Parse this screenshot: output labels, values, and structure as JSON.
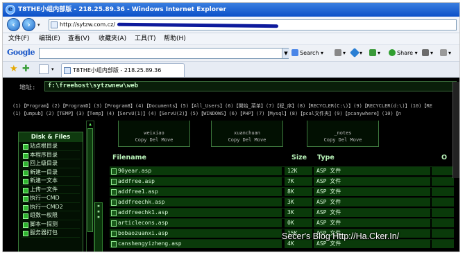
{
  "window": {
    "title": "T8THE小组内部版 - 218.25.89.36 - Windows Internet Explorer"
  },
  "address": {
    "url": "http://sytzw.com.cz/"
  },
  "menu": {
    "items": [
      "文件(F)",
      "编辑(E)",
      "查看(V)",
      "收藏夹(A)",
      "工具(T)",
      "帮助(H)"
    ]
  },
  "google": {
    "logo": "Google",
    "search_label": "Search",
    "share_label": "Share"
  },
  "tab": {
    "title": "T8THE小组内部版 - 218.25.89.36"
  },
  "page": {
    "path_label": "地址:",
    "path_value": "f:\\freehost\\sytzwnew\\web",
    "drives_row1": "(1)【Program】(2)【ProgramD】(3)【Program8】(4)【Documents】(5)【All_Users】(6)【開始_菜单】(7)【程_序】(8)【RECYCLER(C:\\)】(9)【RECYCLER(d:\\)】(10)【RE",
    "drives_row2": "(1)【umpub】(2)【TEMP】(3)【Temp】(4)【ServU(1)】(4)【ServU(2)】(5)【WINDOWS】(6)【PHP】(7)【Mysql】(8)【pcal文件夹】(9)【pcanywhere】(10)【n",
    "sidebar": {
      "title": "Disk & Files",
      "items": [
        "站点根目录",
        "本程序目录",
        "回上级目录",
        "新建一目录",
        "新建一文本",
        "上传一文件",
        "执行一CMD",
        "执行一CMD2",
        "组数一权限",
        "脚本一探测",
        "服务器打包"
      ]
    },
    "folders": [
      {
        "name": "weixiao",
        "ops": "Copy Del Move"
      },
      {
        "name": "xuanchuan",
        "ops": "Copy Del Move"
      },
      {
        "name": "_notes",
        "ops": "Copy Del Move"
      }
    ],
    "table": {
      "headers": {
        "name": "Filename",
        "size": "Size",
        "type": "Type",
        "extra": "O"
      },
      "rows": [
        {
          "name": "90year.asp",
          "size": "12K",
          "type": "ASP 文件"
        },
        {
          "name": "addfree.asp",
          "size": "7K",
          "type": "ASP 文件"
        },
        {
          "name": "addfree1.asp",
          "size": "8K",
          "type": "ASP 文件"
        },
        {
          "name": "addfreechk.asp",
          "size": "3K",
          "type": "ASP 文件"
        },
        {
          "name": "addfreechk1.asp",
          "size": "3K",
          "type": "ASP 文件"
        },
        {
          "name": "articlecons.asp",
          "size": "0K",
          "type": "ASP 文件"
        },
        {
          "name": "bobaozuanxi.asp",
          "size": "15K",
          "type": "ASP 文件"
        },
        {
          "name": "canshengyizheng.asp",
          "size": "4K",
          "type": "ASP 文件"
        }
      ]
    }
  },
  "watermark": "Secer's Blog  Http://Ha.Cker.In/"
}
